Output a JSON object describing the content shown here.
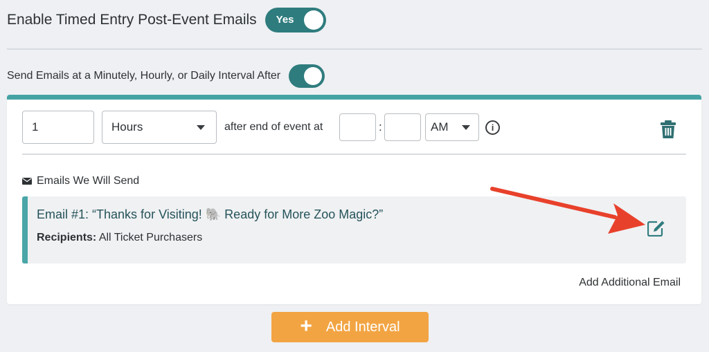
{
  "enable": {
    "label": "Enable Timed Entry Post-Event Emails",
    "toggle_label": "Yes"
  },
  "interval_toggle": {
    "label": "Send Emails at a Minutely, Hourly, or Daily Interval After"
  },
  "interval": {
    "number_value": "1",
    "unit_selected": "Hours",
    "after_text": "after end of event at",
    "hour_value": "",
    "colon": ":",
    "minute_value": "",
    "ampm_selected": "AM"
  },
  "emails": {
    "header": "Emails We Will Send",
    "items": [
      {
        "title": "Email #1: “Thanks for Visiting! 🐘 Ready for More Zoo Magic?”",
        "recipients_label": "Recipients:",
        "recipients_value": "All Ticket Purchasers"
      }
    ],
    "add_label": "Add Additional Email"
  },
  "actions": {
    "add_interval_label": "Add Interval"
  },
  "colors": {
    "teal": "#2f7c7e",
    "accent": "#46a3a4",
    "orange": "#f2a443",
    "arrow": "#e8412b"
  },
  "icons": [
    "info-icon",
    "trash-icon",
    "mail-icon",
    "edit-icon",
    "plus-icon",
    "arrow-annotation"
  ]
}
